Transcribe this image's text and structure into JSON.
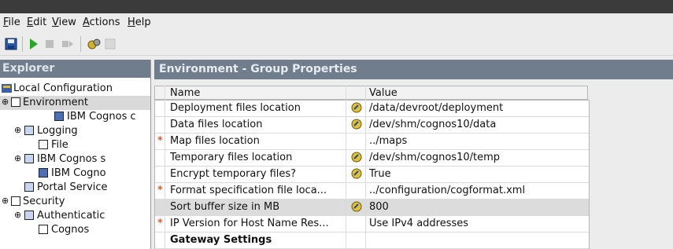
{
  "menu": {
    "file": "File",
    "edit": "Edit",
    "view": "View",
    "actions": "Actions",
    "help": "Help"
  },
  "explorer": {
    "title": "Explorer",
    "items": [
      {
        "label": "Local Configuration",
        "icon": "config-icon"
      },
      {
        "label": "Environment",
        "icon": "group-icon"
      },
      {
        "label": "IBM Cognos c",
        "icon": "component-icon"
      },
      {
        "label": "Logging",
        "icon": "folder-icon"
      },
      {
        "label": "File",
        "icon": "file-icon"
      },
      {
        "label": "IBM Cognos s",
        "icon": "folder-icon"
      },
      {
        "label": "IBM Cogno",
        "icon": "component-icon"
      },
      {
        "label": "Portal Service",
        "icon": "folder-icon"
      },
      {
        "label": "Security",
        "icon": "group-icon"
      },
      {
        "label": "Authenticatic",
        "icon": "folder-icon"
      },
      {
        "label": "Cognos",
        "icon": "file-icon"
      }
    ]
  },
  "properties": {
    "title": "Environment - Group Properties",
    "columns": {
      "name": "Name",
      "value": "Value"
    },
    "rows": [
      {
        "required": "",
        "name": "Deployment files location",
        "icon": "edit-value-icon",
        "value": "/data/devroot/deployment"
      },
      {
        "required": "",
        "name": "Data files location",
        "icon": "edit-value-icon",
        "value": "/dev/shm/cognos10/data"
      },
      {
        "required": "*",
        "name": "Map files location",
        "icon": "",
        "value": "../maps"
      },
      {
        "required": "",
        "name": "Temporary files location",
        "icon": "edit-value-icon",
        "value": "/dev/shm/cognos10/temp"
      },
      {
        "required": "",
        "name": "Encrypt temporary files?",
        "icon": "edit-value-icon",
        "value": "True"
      },
      {
        "required": "*",
        "name": "Format specification file loca...",
        "icon": "",
        "value": "../configuration/cogformat.xml"
      },
      {
        "required": "",
        "name": "Sort buffer size in MB",
        "icon": "edit-value-icon",
        "value": "800"
      },
      {
        "required": "*",
        "name": "IP Version for Host Name Res...",
        "icon": "",
        "value": "Use IPv4 addresses"
      }
    ],
    "section": "Gateway Settings"
  }
}
